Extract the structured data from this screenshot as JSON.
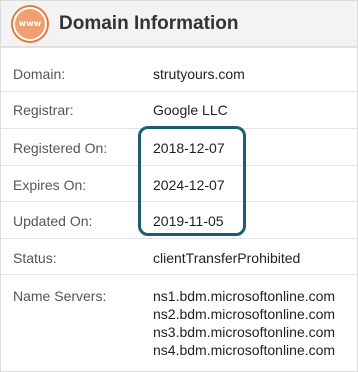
{
  "header": {
    "icon_text": "www",
    "title": "Domain Information"
  },
  "rows": [
    {
      "label": "Domain:",
      "value": "strutyours.com"
    },
    {
      "label": "Registrar:",
      "value": "Google LLC"
    },
    {
      "label": "Registered On:",
      "value": "2018-12-07"
    },
    {
      "label": "Expires On:",
      "value": "2024-12-07"
    },
    {
      "label": "Updated On:",
      "value": "2019-11-05"
    },
    {
      "label": "Status:",
      "value": "clientTransferProhibited"
    }
  ],
  "name_servers": {
    "label": "Name Servers:",
    "values": [
      "ns1.bdm.microsoftonline.com",
      "ns2.bdm.microsoftonline.com",
      "ns3.bdm.microsoftonline.com",
      "ns4.bdm.microsoftonline.com"
    ]
  },
  "colors": {
    "icon_fill": "#f0a070",
    "icon_ring": "#e07a3b",
    "highlight_border": "#1c5d6e"
  }
}
